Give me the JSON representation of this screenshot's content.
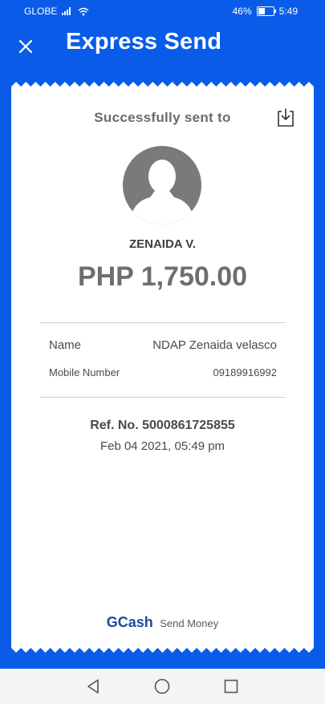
{
  "status_bar": {
    "carrier": "GLOBE",
    "battery_percent": "46%",
    "battery_level": 0.46,
    "time": "5:49",
    "icons": [
      "signal-icon",
      "wifi-icon",
      "battery-icon"
    ]
  },
  "header": {
    "title": "Express Send",
    "close_icon": "close-icon"
  },
  "receipt": {
    "heading": "Successfully sent to",
    "download_icon": "download-icon",
    "avatar_icon": "avatar-icon",
    "recipient_name": "ZENAIDA V.",
    "amount": "PHP 1,750.00",
    "details": [
      {
        "label": "Name",
        "value": "NDAP Zenaida velasco"
      },
      {
        "label": "Mobile Number",
        "value": "09189916992"
      }
    ],
    "reference": "Ref. No. 5000861725855",
    "date": "Feb 04 2021, 05:49 pm",
    "brand": "GCash",
    "brand_caption": "Send Money"
  },
  "nav_bar": {
    "icons": [
      "back-icon",
      "home-icon",
      "recent-apps-icon"
    ]
  },
  "colors": {
    "brand_blue": "#0a5ce8",
    "gcash_blue": "#1c4b9c",
    "receipt_bg": "#ffffff"
  }
}
